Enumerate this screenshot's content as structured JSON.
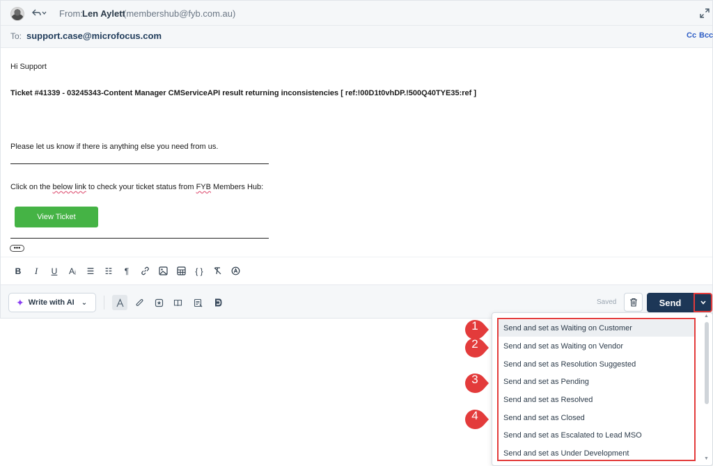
{
  "header": {
    "from_label": "From:",
    "from_name": "Len Aylett",
    "from_email": "(membershub@fyb.com.au)",
    "to_label": "To:",
    "to_email": "support.case@microfocus.com",
    "cc_label": "Cc",
    "bcc_label": "Bcc"
  },
  "body": {
    "greeting": "Hi Support",
    "ticket_line": "Ticket #41339 - 03245343-Content Manager CMServiceAPI result returning inconsistencies [ ref:!00D1t0vhDP.!500Q40TYE35:ref ]",
    "please_line": "Please let us know if there is anything else you need from us.",
    "click_prefix": "Click on the ",
    "click_link": "below link",
    "click_mid": " to check your ticket status from ",
    "click_fyb": "FYB",
    "click_suffix": " Members Hub:",
    "view_ticket_label": "View Ticket",
    "more_label": "•••"
  },
  "format_toolbar": {
    "items": [
      {
        "name": "bold-button",
        "glyph": "B"
      },
      {
        "name": "italic-button",
        "glyph": "I"
      },
      {
        "name": "underline-button",
        "glyph": "U"
      },
      {
        "name": "font-size-button",
        "glyph": "Aᵢ"
      },
      {
        "name": "numbered-list-button",
        "glyph": "☰"
      },
      {
        "name": "bulleted-list-button",
        "glyph": "☷"
      },
      {
        "name": "paragraph-button",
        "glyph": "¶"
      },
      {
        "name": "link-icon",
        "glyph": "🔗"
      },
      {
        "name": "image-icon",
        "glyph": "▣"
      },
      {
        "name": "table-icon",
        "glyph": "⊞"
      },
      {
        "name": "code-icon",
        "glyph": "{ }"
      },
      {
        "name": "clear-format-icon",
        "glyph": "⌀"
      },
      {
        "name": "signature-icon",
        "glyph": "Ⓐ"
      }
    ]
  },
  "action_bar": {
    "write_ai_label": "Write with AI",
    "saved_label": "Saved",
    "send_label": "Send"
  },
  "send_menu": {
    "items": [
      "Send and set as Waiting on Customer",
      "Send and set as Waiting on Vendor",
      "Send and set as Resolution Suggested",
      "Send and set as Pending",
      "Send and set as Resolved",
      "Send and set as Closed",
      "Send and set as Escalated to Lead MSO",
      "Send and set as Under Development"
    ]
  },
  "annotations": {
    "markers": [
      "1",
      "2",
      "3",
      "4"
    ],
    "color": "#e33b3b"
  }
}
